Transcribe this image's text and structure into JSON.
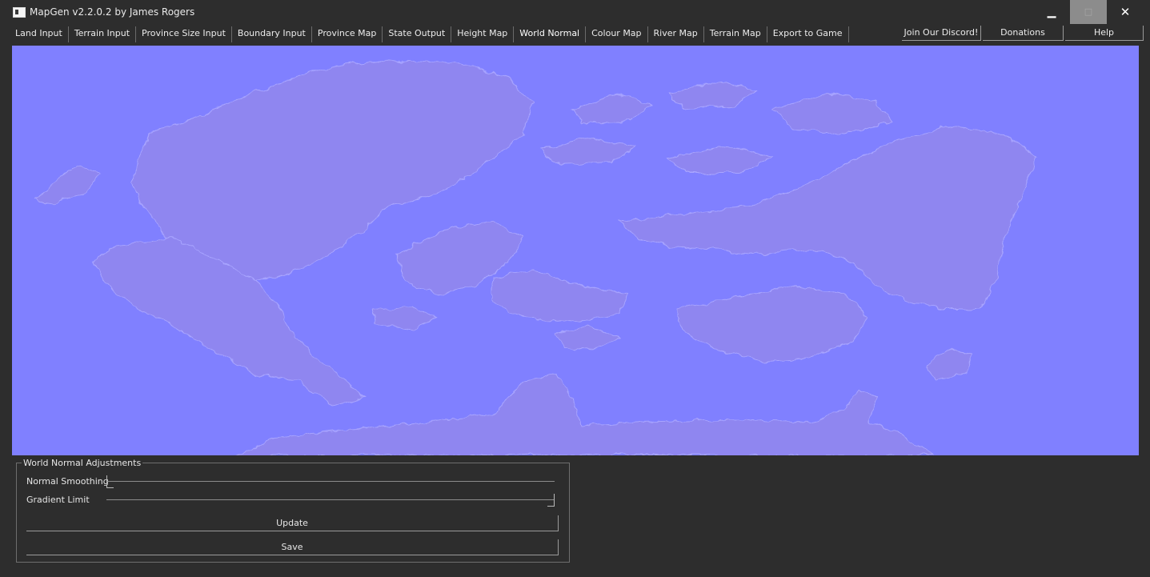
{
  "window": {
    "title": "MapGen v2.2.0.2 by James Rogers",
    "controls": {
      "minimize": "▁",
      "maximize": "□",
      "close": "✕"
    }
  },
  "menu": {
    "tabs": [
      "Land Input",
      "Terrain Input",
      "Province Size Input",
      "Boundary Input",
      "Province Map",
      "State Output",
      "Height Map",
      "World Normal",
      "Colour Map",
      "River Map",
      "Terrain Map",
      "Export to Game"
    ],
    "active": "World Normal"
  },
  "links": {
    "discord": "Join Our Discord!",
    "donations": "Donations",
    "help": "Help"
  },
  "map_view": {
    "background_color": "#8080ff",
    "land_color": "#8f86f0"
  },
  "adjustments": {
    "group_title": "World Normal Adjustments",
    "normal_smoothing": {
      "label": "Normal Smoothing",
      "level": 0.0
    },
    "gradient_limit": {
      "label": "Gradient Limit",
      "level": 1.0
    },
    "update_label": "Update",
    "save_label": "Save"
  }
}
